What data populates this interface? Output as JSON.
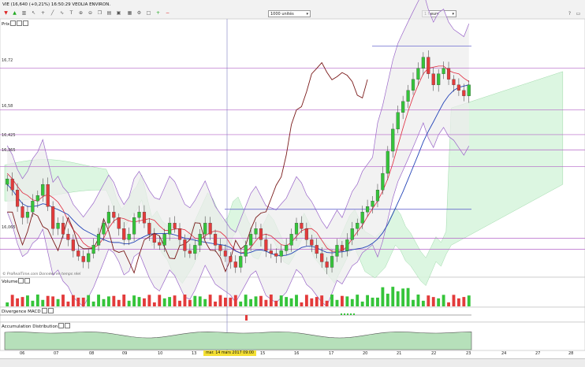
{
  "header": {
    "symbol_text": "VIE (16,640 (+0,21%) 16:50:29 VEOLIA ENVIRON."
  },
  "toolbar": {
    "quantity_select": "1000 unités",
    "period_select": "1 heure",
    "icons": [
      "down-arrow-icon",
      "up-arrow-icon",
      "chart-type-icon",
      "cursor-icon",
      "crosshair-icon",
      "line-tool-icon",
      "indicator-icon",
      "text-tool-icon",
      "zoom-in-icon",
      "zoom-out-icon",
      "copy-icon",
      "print-icon",
      "trash-icon",
      "grid-icon",
      "settings-icon",
      "fullscreen-icon",
      "plus-icon",
      "minus-icon",
      "help-icon",
      "window-icon"
    ]
  },
  "panels": {
    "price": "Prix",
    "volume": "Volume",
    "macd": "Divergence MACD",
    "ad": "Accumulation Distribution"
  },
  "credit": "© ProRealTime.com  Données en temps réel",
  "crosshair_label": "mar. 14 mars 2017 09:00",
  "x_labels": [
    "06",
    "07",
    "08",
    "09",
    "10",
    "13",
    "14",
    "15",
    "16",
    "17",
    "20",
    "21",
    "22",
    "23",
    "24",
    "27",
    "28"
  ],
  "chart_data": [
    {
      "type": "candlestick",
      "title": "Prix",
      "ylim": [
        15.97,
        16.87
      ],
      "price_levels": [
        "16,72",
        "16,58",
        "16,425",
        "16,365",
        "16,065"
      ],
      "horizontal_levels_values": [
        16.72,
        16.57,
        16.48,
        16.425,
        16.365,
        16.105,
        16.065
      ],
      "candles_close_approx": [
        16.32,
        16.28,
        16.22,
        16.18,
        16.2,
        16.24,
        16.26,
        16.3,
        16.22,
        16.14,
        16.16,
        16.12,
        16.1,
        16.06,
        16.04,
        16.02,
        16.05,
        16.08,
        16.12,
        16.16,
        16.2,
        16.18,
        16.14,
        16.1,
        16.12,
        16.18,
        16.2,
        16.16,
        16.12,
        16.09,
        16.08,
        16.12,
        16.16,
        16.14,
        16.1,
        16.06,
        16.05,
        16.08,
        16.12,
        16.16,
        16.12,
        16.08,
        16.06,
        16.04,
        16.02,
        16.0,
        16.04,
        16.08,
        16.12,
        16.14,
        16.1,
        16.06,
        16.05,
        16.04,
        16.06,
        16.08,
        16.12,
        16.16,
        16.14,
        16.1,
        16.08,
        16.05,
        16.02,
        16.0,
        16.04,
        16.08,
        16.06,
        16.1,
        16.14,
        16.16,
        16.2,
        16.22,
        16.24,
        16.28,
        16.34,
        16.42,
        16.5,
        16.56,
        16.6,
        16.64,
        16.68,
        16.72,
        16.76,
        16.7,
        16.66,
        16.7,
        16.72,
        16.68,
        16.66,
        16.64,
        16.62,
        16.66
      ],
      "indicators": [
        "Bollinger bands",
        "Ichimoku cloud",
        "Moving averages"
      ]
    },
    {
      "type": "bar",
      "title": "Volume"
    },
    {
      "type": "bar",
      "title": "Divergence MACD"
    },
    {
      "type": "area",
      "title": "Accumulation Distribution"
    }
  ]
}
